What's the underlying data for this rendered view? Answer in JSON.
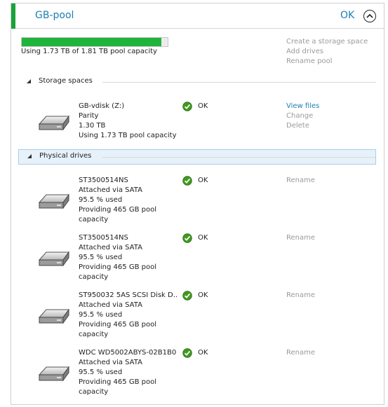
{
  "pool": {
    "title": "GB-pool",
    "status": "OK",
    "capacity_text": "Using 1.73 TB of 1.81 TB pool capacity",
    "usage_fraction": 0.956,
    "actions": [
      "Create a storage space",
      "Add drives",
      "Rename pool"
    ]
  },
  "storage_section": {
    "heading": "Storage spaces",
    "spaces": [
      {
        "lines": [
          "GB-vdisk (Z:)",
          "Parity",
          "1.30 TB",
          "Using 1.73 TB pool capacity"
        ],
        "status": "OK",
        "actions": [
          "View files",
          "Change",
          "Delete"
        ]
      }
    ]
  },
  "drives_section": {
    "heading": "Physical drives",
    "drives": [
      {
        "lines": [
          "ST3500514NS",
          "Attached via SATA",
          "95.5 % used",
          "Providing 465 GB pool",
          "capacity"
        ],
        "status": "OK",
        "action": "Rename"
      },
      {
        "lines": [
          "ST3500514NS",
          "Attached via SATA",
          "95.5 % used",
          "Providing 465 GB pool",
          "capacity"
        ],
        "status": "OK",
        "action": "Rename"
      },
      {
        "lines": [
          "ST950032 5AS SCSI Disk D...",
          "Attached via SATA",
          "95.5 % used",
          "Providing 465 GB pool",
          "capacity"
        ],
        "status": "OK",
        "action": "Rename"
      },
      {
        "lines": [
          "WDC WD5002ABYS-02B1B0",
          "Attached via SATA",
          "95.5 % used",
          "Providing 465 GB pool",
          "capacity"
        ],
        "status": "OK",
        "action": "Rename"
      }
    ]
  },
  "colors": {
    "accent_green": "#1aa33a",
    "progress_green": "#21b43c",
    "link_blue": "#1c7fb0",
    "disabled_gray": "#9a9a9a"
  },
  "icons": {
    "drive": "hard-drive-icon",
    "status_ok": "checkmark-circle-icon",
    "collapse": "chevron-up-icon",
    "section_toggle": "triangle-expanded-icon"
  }
}
